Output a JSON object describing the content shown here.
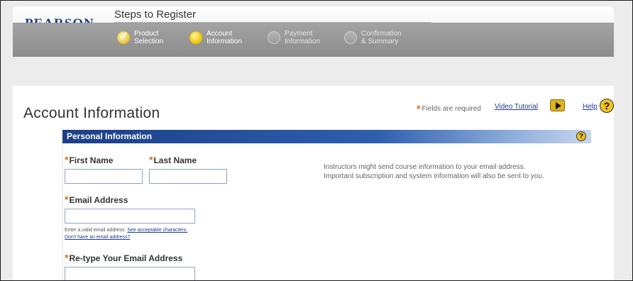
{
  "brand": {
    "logo_text": "PEARSON"
  },
  "steps": {
    "title": "Steps to Register",
    "items": [
      {
        "label": "Product\nSelection",
        "state": "done"
      },
      {
        "label": "Account\nInformation",
        "state": "active"
      },
      {
        "label": "Payment\nInformation",
        "state": "pending"
      },
      {
        "label": "Confirmation\n& Summary",
        "state": "pending"
      }
    ]
  },
  "page": {
    "title": "Account Information",
    "required_note": "Fields are required",
    "video_tutorial": "Video Tutorial",
    "help": "Help"
  },
  "panel": {
    "title": "Personal Information"
  },
  "form": {
    "first_name_label": "First Name",
    "last_name_label": "Last Name",
    "email_label": "Email Address",
    "email_hint": "Enter a valid email address.",
    "email_hint_link": "See acceptable characters.",
    "no_email_link": "Don't have an email address?",
    "retype_email_label": "Re-type Your Email Address",
    "first_name_value": "",
    "last_name_value": "",
    "email_value": "",
    "retype_email_value": ""
  },
  "info_text": "Instructors might send course information to your email address. Important subscription and system information will also be sent to you.",
  "colors": {
    "accent_orange": "#e06a14",
    "panel_blue": "#1b3e86",
    "link_blue": "#1d3c8f",
    "step_yellow": "#f5d21b"
  },
  "icons": {
    "video": "play-icon",
    "help": "help-question-icon"
  }
}
